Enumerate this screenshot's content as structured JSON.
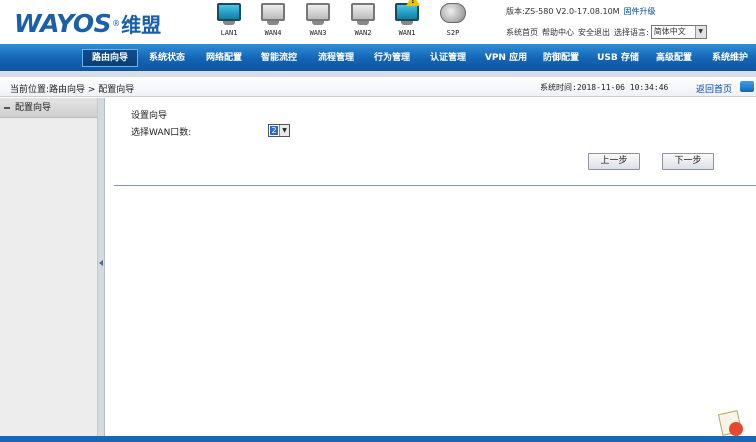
{
  "header": {
    "brand": "WAYOS",
    "brand_reg": "®",
    "brand_cn": "维盟",
    "ports": [
      {
        "label": "LAN1",
        "state": "active"
      },
      {
        "label": "WAN4",
        "state": "inactive"
      },
      {
        "label": "WAN3",
        "state": "inactive"
      },
      {
        "label": "WAN2",
        "state": "inactive"
      },
      {
        "label": "WAN1",
        "state": "active-warning"
      }
    ],
    "s2p_label": "S2P",
    "version_text": "版本:ZS-580 V2.0-17.08.10M",
    "upgrade_link": "固件升级",
    "links": [
      "系统首页",
      "帮助中心",
      "安全退出"
    ],
    "lang_label": "选择语言:",
    "lang_selected": "简体中文"
  },
  "nav": {
    "items": [
      {
        "label": "路由向导",
        "active": true
      },
      {
        "label": "系统状态",
        "active": false
      },
      {
        "label": "网络配置",
        "active": false
      },
      {
        "label": "智能流控",
        "active": false
      },
      {
        "label": "流程管理",
        "active": false
      },
      {
        "label": "行为管理",
        "active": false
      },
      {
        "label": "认证管理",
        "active": false
      },
      {
        "label": "VPN 应用",
        "active": false
      },
      {
        "label": "防御配置",
        "active": false
      },
      {
        "label": "USB 存储",
        "active": false
      },
      {
        "label": "高级配置",
        "active": false
      },
      {
        "label": "系统维护",
        "active": false
      }
    ]
  },
  "crumbbar": {
    "breadcrumb": "当前位置:路由向导 > 配置向导",
    "system_time": "系统时间:2018-11-06 10:34:46",
    "home_link": "返回首页"
  },
  "sidebar": {
    "items": [
      {
        "label": "配置向导"
      }
    ]
  },
  "main": {
    "wizard_title": "设置向导",
    "field_label": "选择WAN口数:",
    "wan_count": "2",
    "prev_label": "上一步",
    "next_label": "下一步"
  },
  "colors": {
    "nav_blue": "#1464b4",
    "brand_blue": "#1a5fa8",
    "link_blue": "#0048a8"
  }
}
